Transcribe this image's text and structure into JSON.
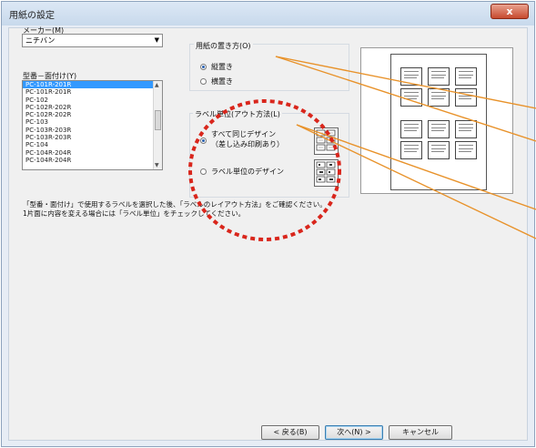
{
  "window": {
    "title": "用紙の設定",
    "close_label": "x"
  },
  "maker": {
    "label": "メーカー(M)",
    "selected": "ニチバン"
  },
  "model_list": {
    "label": "型番－面付け(Y)",
    "items": [
      "PC-101R-201R",
      "PC-101R-201R",
      "PC-102",
      "PC-102R-202R",
      "PC-102R-202R",
      "PC-103",
      "PC-103R-203R",
      "PC-103R-203R",
      "PC-104",
      "PC-104R-204R",
      "PC-104R-204R"
    ],
    "selected_index": 0
  },
  "orientation": {
    "label": "用紙の置き方(O)",
    "options": [
      "縦置き",
      "横置き"
    ],
    "selected": 0
  },
  "label_layout": {
    "label": "ラベル単位(アウト方法(L)",
    "option1_line1": "すべて同じデザイン",
    "option1_line2": "（差し込み印刷あり）",
    "option2": "ラベル単位のデザイン",
    "selected": 0
  },
  "note": {
    "line1": "「型番・面付け」で使用するラベルを選択した後、「ラベルのレイアウト方法」をご確認ください。",
    "line2": "1片面に内容を変える場合には「ラベル単位」をチェックしてください。"
  },
  "buttons": {
    "back": "< 戻る(B)",
    "next": "次へ(N) >",
    "cancel": "キャンセル"
  },
  "colors": {
    "highlight_circle": "#d9261c",
    "callout_line": "#e8922a",
    "selection": "#3399ff"
  }
}
